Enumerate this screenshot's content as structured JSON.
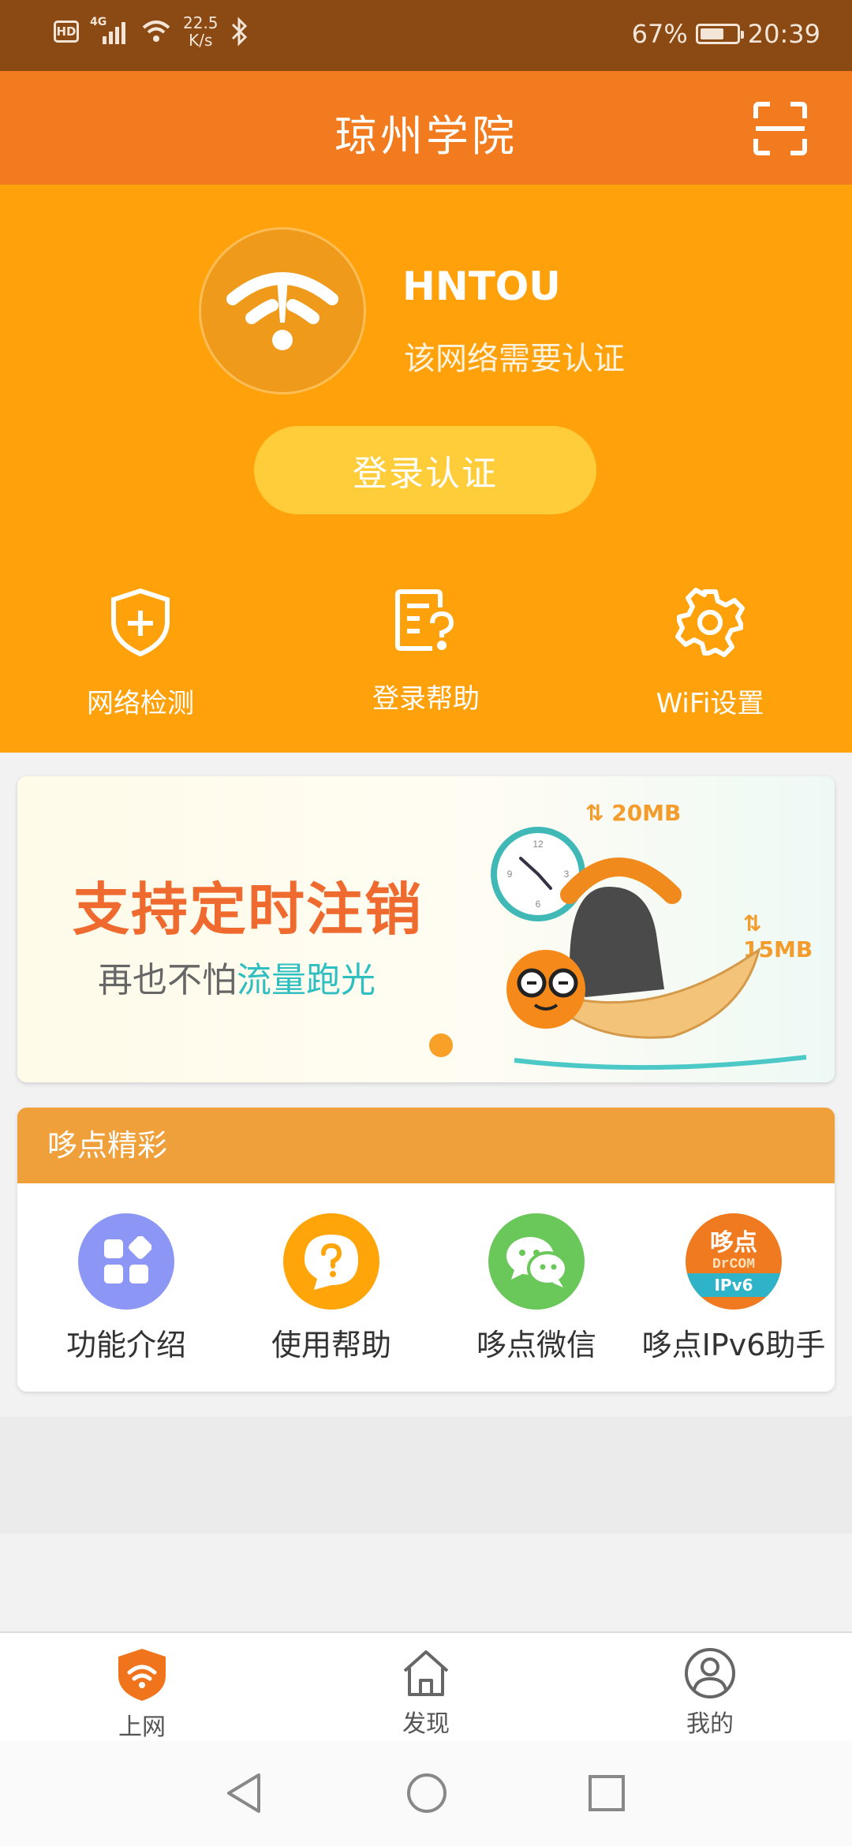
{
  "status_bar": {
    "hd": "HD",
    "network_type": "4G",
    "speed_value": "22.5",
    "speed_unit": "K/s",
    "battery_percent": "67%",
    "battery_level": 0.67,
    "time": "20:39"
  },
  "header": {
    "title": "琼州学院"
  },
  "hero": {
    "ssid": "HNTOU",
    "status": "该网络需要认证",
    "login_button": "登录认证",
    "quick_actions": [
      {
        "label": "网络检测",
        "icon": "shield-plus-icon"
      },
      {
        "label": "登录帮助",
        "icon": "help-document-icon"
      },
      {
        "label": "WiFi设置",
        "icon": "gear-icon"
      }
    ]
  },
  "banner": {
    "title": "支持定时注销",
    "subtitle_prefix": "再也不怕",
    "subtitle_highlight": "流量跑光",
    "tag_top": "20MB",
    "tag_right": "15MB",
    "clock_numbers": [
      "12",
      "3",
      "6",
      "9"
    ]
  },
  "section": {
    "title": "哆点精彩",
    "apps": [
      {
        "label": "功能介绍",
        "icon": "features-grid-icon",
        "color": "#8c96f5"
      },
      {
        "label": "使用帮助",
        "icon": "help-bubble-icon",
        "color": "#ffa50a"
      },
      {
        "label": "哆点微信",
        "icon": "wechat-icon",
        "color": "#6ac85a"
      },
      {
        "label": "哆点IPv6助手",
        "icon": "drcom-ipv6-icon",
        "color": "#f07a20",
        "icon_text_top": "哆点",
        "icon_text_mid": "DrCOM",
        "icon_text_bottom": "IPv6"
      }
    ]
  },
  "bottom_nav": {
    "items": [
      {
        "label": "上网",
        "icon": "wifi-shield-icon",
        "active": true
      },
      {
        "label": "发现",
        "icon": "home-icon",
        "active": false
      },
      {
        "label": "我的",
        "icon": "user-icon",
        "active": false
      }
    ]
  },
  "colors": {
    "status_bar": "#8b4a14",
    "header": "#f27b1f",
    "hero": "#ffa10a",
    "login_button": "#ffcd3a",
    "section_header": "#f0a03a"
  }
}
